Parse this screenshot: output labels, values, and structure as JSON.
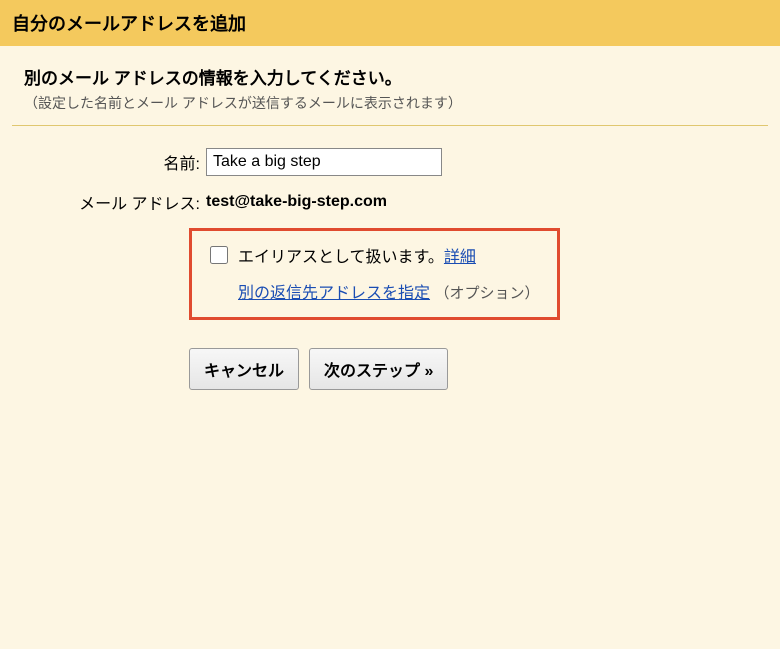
{
  "header": {
    "title": "自分のメールアドレスを追加"
  },
  "section": {
    "subtitle": "別のメール アドレスの情報を入力してください。",
    "note": "（設定した名前とメール アドレスが送信するメールに表示されます）"
  },
  "form": {
    "name_label": "名前:",
    "name_value": "Take a big step",
    "email_label": "メール アドレス:",
    "email_value": "test@take-big-step.com",
    "alias_text": "エイリアスとして扱います。",
    "alias_link": "詳細",
    "reply_link": "別の返信先アドレスを指定",
    "reply_option": "（オプション）"
  },
  "buttons": {
    "cancel": "キャンセル",
    "next": "次のステップ »"
  }
}
